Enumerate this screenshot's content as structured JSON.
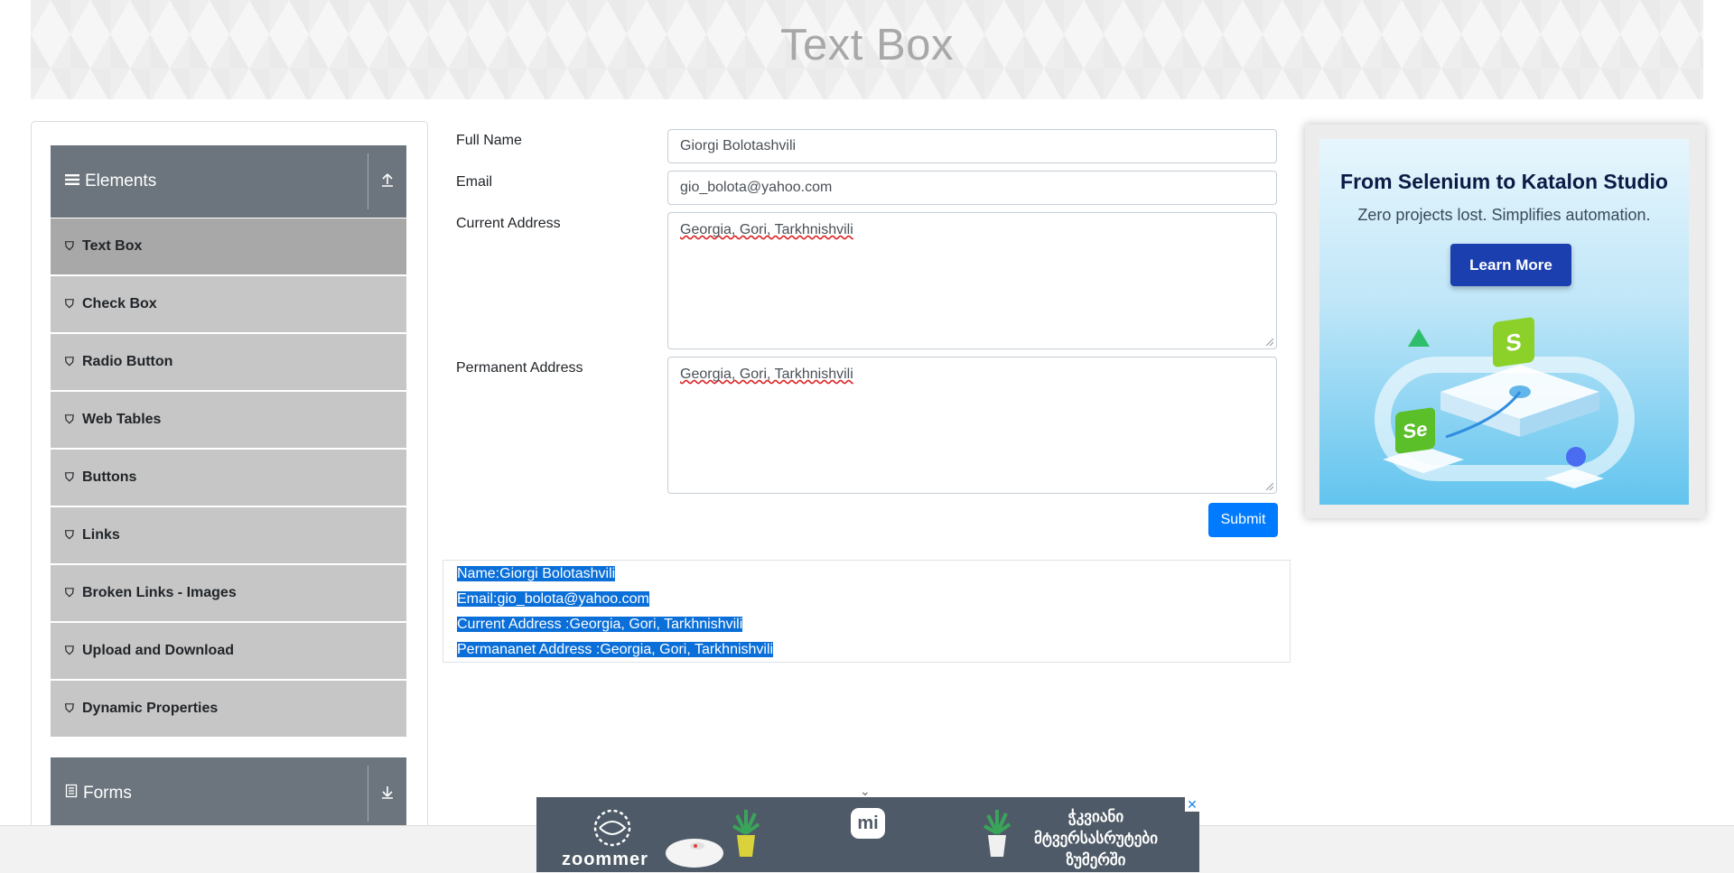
{
  "header": {
    "title": "Text Box"
  },
  "sidebar": {
    "elements_group": {
      "label": "Elements",
      "menu_icon": "menu-icon",
      "toggle_icon": "collapse-up-icon"
    },
    "items": [
      {
        "label": "Text Box",
        "active": true
      },
      {
        "label": "Check Box"
      },
      {
        "label": "Radio Button"
      },
      {
        "label": "Web Tables"
      },
      {
        "label": "Buttons"
      },
      {
        "label": "Links"
      },
      {
        "label": "Broken Links - Images"
      },
      {
        "label": "Upload and Download"
      },
      {
        "label": "Dynamic Properties"
      }
    ],
    "item_icon": "html5-icon",
    "forms_group": {
      "label": "Forms",
      "icon": "form-icon",
      "toggle_icon": "expand-down-icon"
    }
  },
  "form": {
    "full_name_label": "Full Name",
    "full_name_value": "Giorgi Bolotashvili",
    "email_label": "Email",
    "email_value": "gio_bolota@yahoo.com",
    "current_address_label": "Current Address",
    "current_address_value": "Georgia, Gori, Tarkhnishvili",
    "permanent_address_label": "Permanent Address",
    "permanent_address_value": "Georgia, Gori, Tarkhnishvili",
    "submit_label": "Submit"
  },
  "output": {
    "name": "Name:Giorgi Bolotashvili",
    "email": "Email:gio_bolota@yahoo.com",
    "current_address": "Current Address :Georgia, Gori, Tarkhnishvili",
    "permanent_address": "Permananet Address :Georgia, Gori, Tarkhnishvili"
  },
  "ad": {
    "title": "From Selenium to Katalon Studio",
    "subtitle": "Zero projects lost. Simplifies automation.",
    "button": "Learn More",
    "badge_s": "S",
    "badge_se": "Se"
  },
  "bottom_banner": {
    "brand": "zoommer",
    "mi": "mi",
    "geo_line1": "ჭკვიანი",
    "geo_line2": "მტვერსასრუტები",
    "geo_line3": "ზუმერში",
    "close": "✕"
  },
  "colors": {
    "primary": "#007bff",
    "sidebar_header": "#6c757d",
    "sidebar_item": "#c6c6c6",
    "active_item": "#a8a8a8",
    "highlight": "#0a6fd8"
  }
}
